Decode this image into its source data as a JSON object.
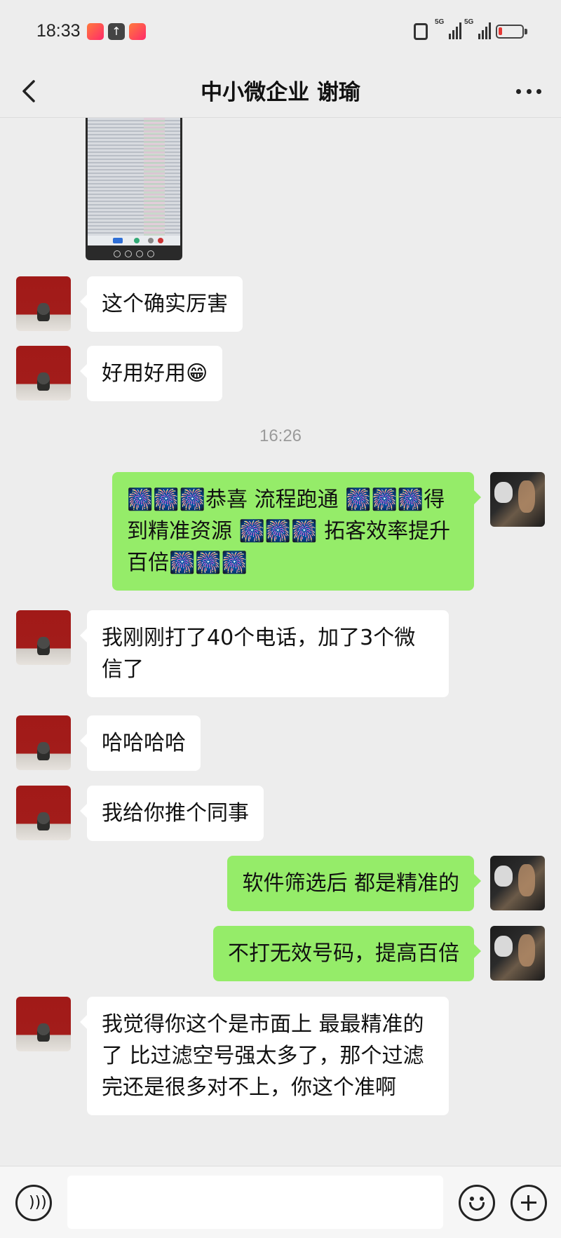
{
  "status_bar": {
    "time": "18:33",
    "network_1": "5G",
    "network_2": "5G",
    "battery_color": "#e53935"
  },
  "nav": {
    "title": "中小微企业  谢瑜",
    "back_icon": "chevron-left-icon",
    "more_icon": "more-dots-icon"
  },
  "messages": [
    {
      "type": "image",
      "from": "peer",
      "desc_icon": "screenshot-thumbnail"
    },
    {
      "type": "text",
      "from": "peer",
      "text": "这个确实厉害"
    },
    {
      "type": "text",
      "from": "peer",
      "text": "好用好用😁"
    },
    {
      "type": "time",
      "text": "16:26"
    },
    {
      "type": "text",
      "from": "me",
      "text": "🎆🎆🎆恭喜 流程跑通 🎆🎆🎆得到精准资源 🎆🎆🎆 拓客效率提升百倍🎆🎆🎆"
    },
    {
      "type": "text",
      "from": "peer",
      "text": "我刚刚打了40个电话，加了3个微信了"
    },
    {
      "type": "text",
      "from": "peer",
      "text": "哈哈哈哈"
    },
    {
      "type": "text",
      "from": "peer",
      "text": "我给你推个同事"
    },
    {
      "type": "text",
      "from": "me",
      "text": "软件筛选后   都是精准的"
    },
    {
      "type": "text",
      "from": "me",
      "text": "不打无效号码，提高百倍"
    },
    {
      "type": "text",
      "from": "peer",
      "text": "我觉得你这个是市面上  最最精准的了   比过滤空号强太多了，那个过滤完还是很多对不上，你这个准啊"
    }
  ],
  "input_bar": {
    "value": "",
    "voice_icon": "voice-icon",
    "emoji_icon": "emoji-icon",
    "plus_icon": "plus-icon"
  },
  "colors": {
    "background": "#ededed",
    "outgoing_bubble": "#95ec69",
    "incoming_bubble": "#ffffff"
  }
}
